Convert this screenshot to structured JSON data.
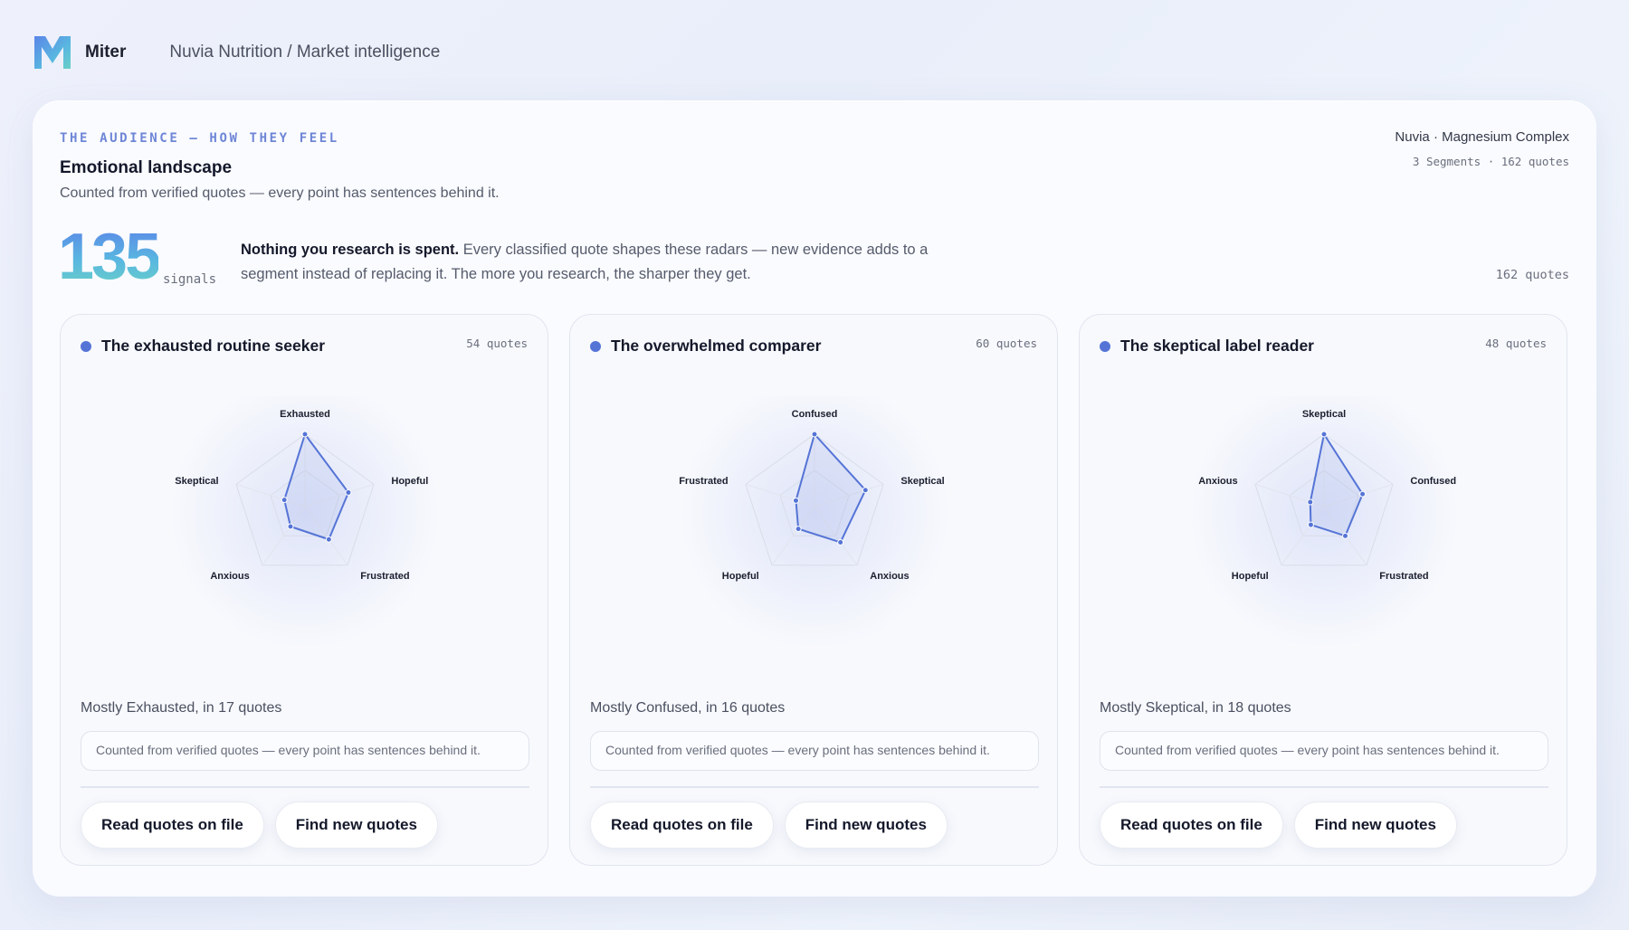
{
  "app": {
    "brand": "Miter",
    "breadcrumb": "Nuvia Nutrition / Market intelligence",
    "logo_icon": "miter-logo-icon"
  },
  "colors": {
    "accent": "#5574d6",
    "eyebrow": "#6e86d6",
    "number_gradient": [
      "#5b85e8",
      "#59b7e0",
      "#6ad0c7"
    ]
  },
  "header": {
    "eyebrow": "THE AUDIENCE — HOW THEY FEEL",
    "title": "Emotional landscape",
    "subtitle": "Counted from verified quotes — every point has sentences behind it.",
    "product": "Nuvia · Magnesium Complex",
    "meta": "3 Segments · 162 quotes"
  },
  "stats": {
    "signals_value": "135",
    "signals_label": "signals",
    "lede_bold": "Nothing you research is spent.",
    "lede_text": " Every classified quote shapes these radars — new evidence adds to a segment instead of replacing it. The more you research, the sharper they get.",
    "total_quotes": "162 quotes"
  },
  "segments": [
    {
      "title": "The exhausted routine seeker",
      "count": "54 quotes",
      "summary": "Mostly Exhausted, in 17 quotes",
      "note": "Counted from verified quotes — every point has sentences behind it.",
      "read_button": "Read quotes on file",
      "find_button": "Find new quotes"
    },
    {
      "title": "The overwhelmed comparer",
      "count": "60 quotes",
      "summary": "Mostly Confused, in 16 quotes",
      "note": "Counted from verified quotes — every point has sentences behind it.",
      "read_button": "Read quotes on file",
      "find_button": "Find new quotes"
    },
    {
      "title": "The skeptical label reader",
      "count": "48 quotes",
      "summary": "Mostly Skeptical, in 18 quotes",
      "note": "Counted from verified quotes — every point has sentences behind it.",
      "read_button": "Read quotes on file",
      "find_button": "Find new quotes"
    }
  ],
  "chart_data": [
    {
      "type": "radar",
      "axes": [
        "Exhausted",
        "Hopeful",
        "Frustrated",
        "Anxious",
        "Skeptical"
      ],
      "values": [
        1.0,
        0.63,
        0.56,
        0.34,
        0.3
      ],
      "range": [
        0,
        1
      ],
      "grid": true,
      "color": "#5574d6"
    },
    {
      "type": "radar",
      "axes": [
        "Confused",
        "Skeptical",
        "Anxious",
        "Hopeful",
        "Frustrated"
      ],
      "values": [
        1.0,
        0.74,
        0.61,
        0.38,
        0.27
      ],
      "range": [
        0,
        1
      ],
      "grid": true,
      "color": "#5574d6"
    },
    {
      "type": "radar",
      "axes": [
        "Skeptical",
        "Confused",
        "Frustrated",
        "Hopeful",
        "Anxious"
      ],
      "values": [
        1.0,
        0.56,
        0.5,
        0.31,
        0.2
      ],
      "range": [
        0,
        1
      ],
      "grid": true,
      "color": "#5574d6"
    }
  ]
}
